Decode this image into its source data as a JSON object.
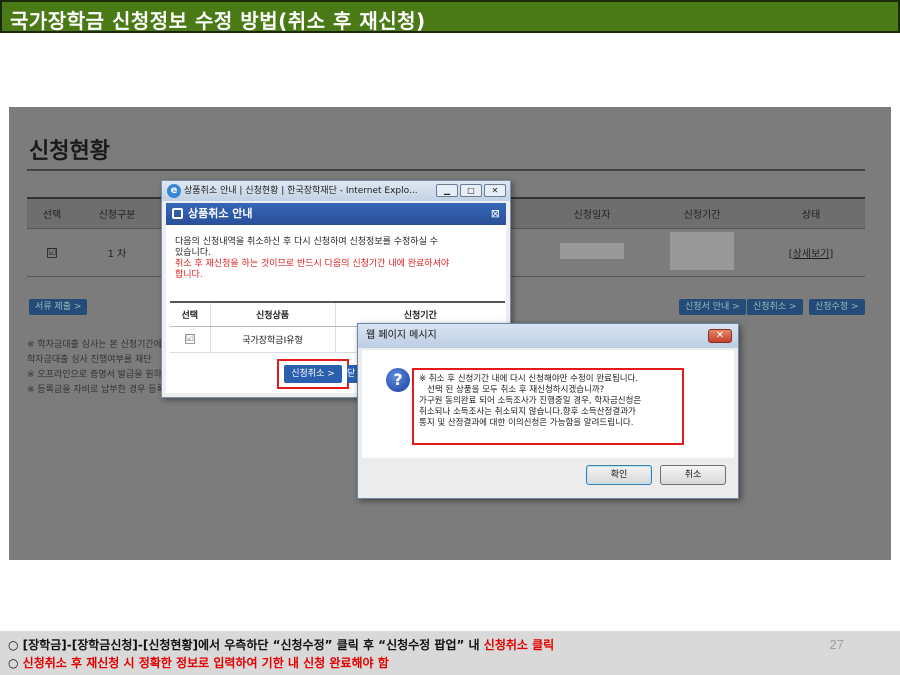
{
  "slide": {
    "title": "국가장학금 신청정보 수정 방법(취소 후 재신청)",
    "page_number": "27"
  },
  "app": {
    "heading": "신청현황",
    "table": {
      "headers": [
        "선택",
        "신청구분",
        "",
        "신청일자",
        "신청기간",
        "상태"
      ],
      "row": {
        "checkbox": "☑",
        "round": "1 차",
        "status_link": "[상세보기]"
      }
    },
    "buttons": {
      "submit_docs": "서류 제출 >",
      "apply_info": "신청서 안내 >",
      "apply_cancel": "신청취소 >",
      "apply_edit": "신청수정 >"
    },
    "notes": [
      "※ 학자금대출 심사는 본 신청기간에",
      "   학자금대출 심사 진행여부를 재단",
      "※ 오프라인으로 증명서 발급을 원하",
      "※ 등록금을 자비로 납부한 경우 등록"
    ]
  },
  "popup1": {
    "window_title": "상품취소 안내 | 신청현황 | 한국장학재단 - Internet Explo...",
    "header": "상품취소 안내",
    "message_line1": "다음의 신청내역을 취소하신 후 다시 신청하여 신청정보를 수정하실 수",
    "message_line2": "있습니다.",
    "warning_line1": "취소 후 재신청을 하는 것이므로 반드시 다음의 신청기간 내에 완료하셔야",
    "warning_line2": "합니다.",
    "table_headers": [
      "선택",
      "신청상품",
      "신청기간"
    ],
    "table_row": {
      "checkbox": "☑",
      "product": "국가장학금I유형",
      "period": ""
    },
    "cancel_button": "신청취소 >",
    "cut_button": "닫"
  },
  "popup2": {
    "window_title": "웹 페이지 메시지",
    "close": "✕",
    "lines": [
      "※ 취소 후 신청기간 내에 다시 신청해야만 수정이 완료됩니다.",
      "   선택 된 상품을 모두 취소 후 재신청하시겠습니까?",
      "가구원 동의완료 되어 소득조사가 진행중일 경우, 학자금신청은",
      "취소되나 소득조사는 취소되지 않습니다.향후 소득산정결과가",
      "통지 및 산정결과에 대한 이의신청은 가능함을 알려드립니다."
    ],
    "ok_button": "확인",
    "cancel_button": "취소"
  },
  "footer": {
    "line1_prefix": "○ [장학금]-[장학금신청]-[신청현황]에서 우측하단 “신청수정” 클릭 후 “신청수정 팝업” 내 ",
    "line1_highlight": "신청취소 클릭",
    "line2_bullet": "○ ",
    "line2_highlight": "신청취소 후 재신청 시 정확한 정보로 입력하여 기한 내 신청 완료해야 함"
  },
  "colors": {
    "title_bg": "#4a7a16",
    "highlight_red": "#e40000",
    "dim_bg": "#7c7c7c",
    "popup_header": "#2d58a8"
  }
}
